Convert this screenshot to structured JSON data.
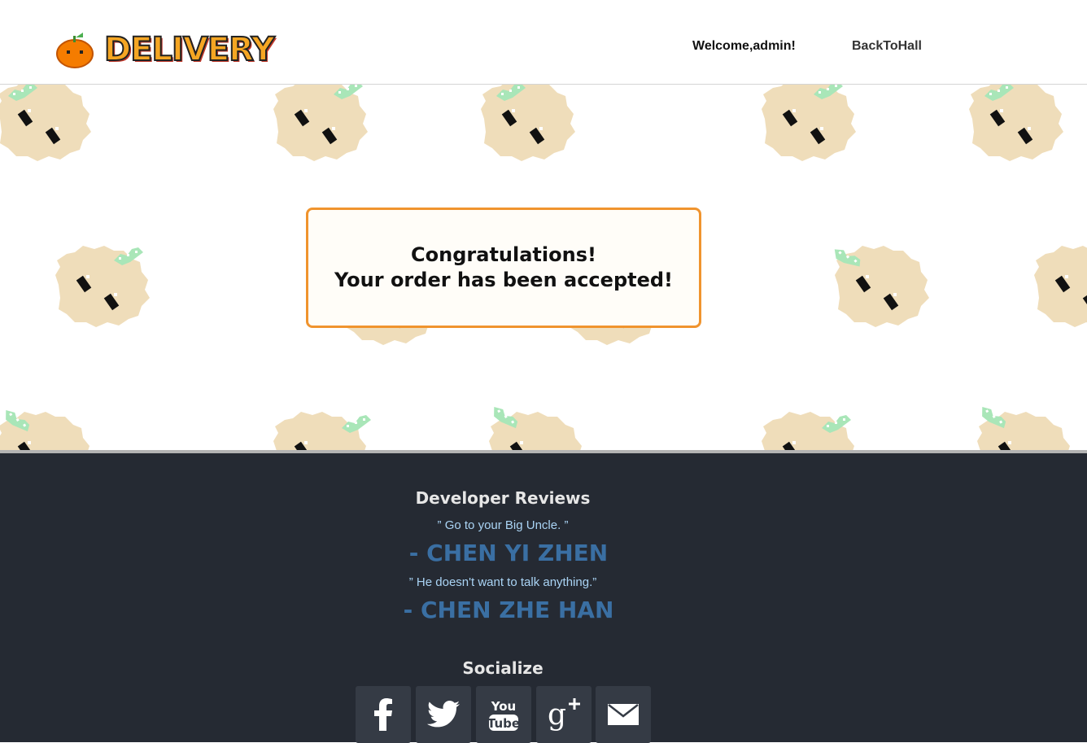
{
  "header": {
    "logo_text": "DELIVERY",
    "welcome": "Welcome,admin!",
    "back_link": "BackToHall"
  },
  "message": {
    "line1": "Congratulations!",
    "line2": "Your order has been accepted!"
  },
  "footer": {
    "reviews_title": "Developer Reviews",
    "reviews": [
      {
        "quote": "” Go to your Big Uncle. ”",
        "author": "- CHEN YI ZHEN"
      },
      {
        "quote": "” He doesn't want to talk anything.”",
        "author": "- CHEN ZHE HAN"
      }
    ],
    "socialize_title": "Socialize",
    "social": [
      {
        "name": "facebook",
        "icon": "facebook-icon"
      },
      {
        "name": "twitter",
        "icon": "twitter-icon"
      },
      {
        "name": "youtube",
        "icon": "youtube-icon"
      },
      {
        "name": "google-plus",
        "icon": "google-plus-icon"
      },
      {
        "name": "email",
        "icon": "mail-icon"
      }
    ]
  },
  "colors": {
    "accent_orange": "#f0942e",
    "footer_bg": "#252a33",
    "author_blue": "#3a6fa3",
    "quote_blue": "#aad4f5",
    "bun_fill": "#efddba",
    "leaf_green": "#a9e6b8"
  }
}
